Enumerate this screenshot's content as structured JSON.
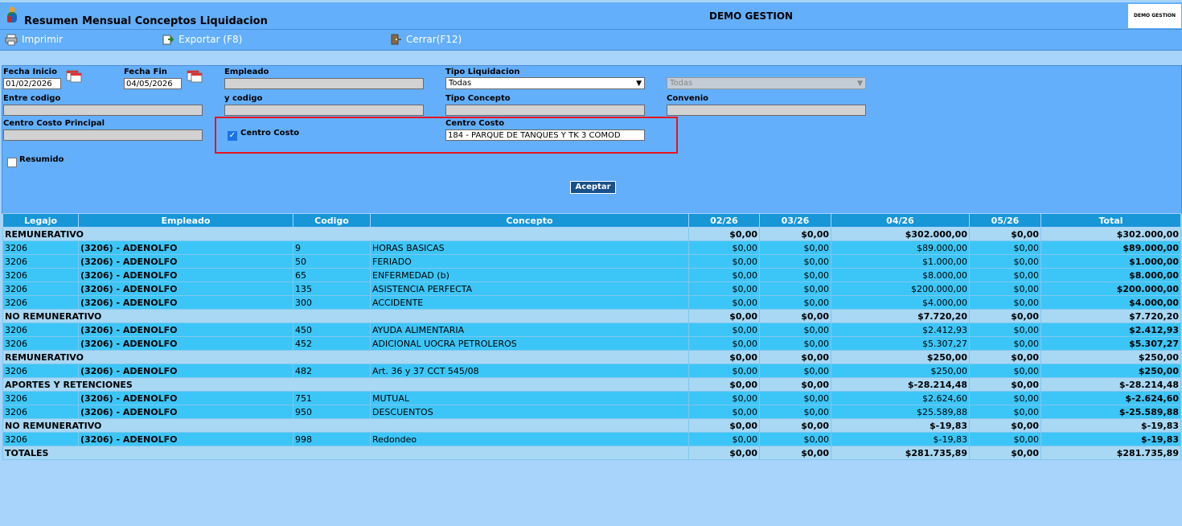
{
  "header": {
    "app_title": "Resumen Mensual Conceptos Liquidacion",
    "center_title": "DEMO GESTION",
    "brand": "DEMO GESTION"
  },
  "toolbar": {
    "print_label": "Imprimir",
    "export_label": "Exportar (F8)",
    "close_label": "Cerrar(F12)"
  },
  "filters": {
    "fecha_inicio_label": "Fecha Inicio",
    "fecha_inicio_value": "01/02/2026",
    "fecha_fin_label": "Fecha Fin",
    "fecha_fin_value": "04/05/2026",
    "empleado_label": "Empleado",
    "tipo_liq_label": "Tipo Liquidacion",
    "tipo_liq_value": "Todas",
    "extra_select_value": "Todas",
    "entre_codigo_label": "Entre codigo",
    "y_codigo_label": "y codigo",
    "tipo_concepto_label": "Tipo Concepto",
    "convenio_label": "Convenio",
    "centro_costo_principal_label": "Centro Costo Principal",
    "centro_costo_chk_label": "Centro Costo",
    "centro_costo_label": "Centro Costo",
    "centro_costo_value": "184 - PARQUE DE TANQUES Y TK 3 COMOD",
    "resumido_label": "Resumido",
    "accept_label": "Aceptar"
  },
  "table": {
    "columns": [
      "Legajo",
      "Empleado",
      "Codigo",
      "Concepto",
      "02/26",
      "03/26",
      "04/26",
      "05/26",
      "Total"
    ],
    "rows": [
      {
        "type": "grp",
        "title": "REMUNERATIVO",
        "vals": [
          "$0,00",
          "$0,00",
          "$302.000,00",
          "$0,00",
          "$302.000,00"
        ]
      },
      {
        "type": "det",
        "legajo": "3206",
        "empleado": "(3206) - ADENOLFO",
        "codigo": "9",
        "concepto": "HORAS BASICAS",
        "vals": [
          "$0,00",
          "$0,00",
          "$89.000,00",
          "$0,00",
          "$89.000,00"
        ]
      },
      {
        "type": "det",
        "legajo": "3206",
        "empleado": "(3206) - ADENOLFO",
        "codigo": "50",
        "concepto": "FERIADO",
        "vals": [
          "$0,00",
          "$0,00",
          "$1.000,00",
          "$0,00",
          "$1.000,00"
        ]
      },
      {
        "type": "det",
        "legajo": "3206",
        "empleado": "(3206) - ADENOLFO",
        "codigo": "65",
        "concepto": "ENFERMEDAD (b)",
        "vals": [
          "$0,00",
          "$0,00",
          "$8.000,00",
          "$0,00",
          "$8.000,00"
        ]
      },
      {
        "type": "det",
        "legajo": "3206",
        "empleado": "(3206) - ADENOLFO",
        "codigo": "135",
        "concepto": "ASISTENCIA PERFECTA",
        "vals": [
          "$0,00",
          "$0,00",
          "$200.000,00",
          "$0,00",
          "$200.000,00"
        ]
      },
      {
        "type": "det",
        "legajo": "3206",
        "empleado": "(3206) - ADENOLFO",
        "codigo": "300",
        "concepto": "ACCIDENTE",
        "vals": [
          "$0,00",
          "$0,00",
          "$4.000,00",
          "$0,00",
          "$4.000,00"
        ]
      },
      {
        "type": "grp",
        "title": "NO REMUNERATIVO",
        "vals": [
          "$0,00",
          "$0,00",
          "$7.720,20",
          "$0,00",
          "$7.720,20"
        ]
      },
      {
        "type": "det",
        "legajo": "3206",
        "empleado": "(3206) - ADENOLFO",
        "codigo": "450",
        "concepto": "AYUDA ALIMENTARIA",
        "vals": [
          "$0,00",
          "$0,00",
          "$2.412,93",
          "$0,00",
          "$2.412,93"
        ]
      },
      {
        "type": "det",
        "legajo": "3206",
        "empleado": "(3206) - ADENOLFO",
        "codigo": "452",
        "concepto": "ADICIONAL UOCRA PETROLEROS",
        "vals": [
          "$0,00",
          "$0,00",
          "$5.307,27",
          "$0,00",
          "$5.307,27"
        ]
      },
      {
        "type": "grp",
        "title": "REMUNERATIVO",
        "vals": [
          "$0,00",
          "$0,00",
          "$250,00",
          "$0,00",
          "$250,00"
        ]
      },
      {
        "type": "det",
        "legajo": "3206",
        "empleado": "(3206) - ADENOLFO",
        "codigo": "482",
        "concepto": "Art. 36 y 37 CCT 545/08",
        "vals": [
          "$0,00",
          "$0,00",
          "$250,00",
          "$0,00",
          "$250,00"
        ]
      },
      {
        "type": "grp",
        "title": "APORTES Y RETENCIONES",
        "vals": [
          "$0,00",
          "$0,00",
          "$-28.214,48",
          "$0,00",
          "$-28.214,48"
        ]
      },
      {
        "type": "det",
        "legajo": "3206",
        "empleado": "(3206) - ADENOLFO",
        "codigo": "751",
        "concepto": "MUTUAL",
        "vals": [
          "$0,00",
          "$0,00",
          "$2.624,60",
          "$0,00",
          "$-2.624,60"
        ]
      },
      {
        "type": "det",
        "legajo": "3206",
        "empleado": "(3206) - ADENOLFO",
        "codigo": "950",
        "concepto": "DESCUENTOS",
        "vals": [
          "$0,00",
          "$0,00",
          "$25.589,88",
          "$0,00",
          "$-25.589,88"
        ]
      },
      {
        "type": "grp",
        "title": "NO REMUNERATIVO",
        "vals": [
          "$0,00",
          "$0,00",
          "$-19,83",
          "$0,00",
          "$-19,83"
        ]
      },
      {
        "type": "det",
        "legajo": "3206",
        "empleado": "(3206) - ADENOLFO",
        "codigo": "998",
        "concepto": "Redondeo",
        "vals": [
          "$0,00",
          "$0,00",
          "$-19,83",
          "$0,00",
          "$-19,83"
        ]
      },
      {
        "type": "tot",
        "title": "TOTALES",
        "vals": [
          "$0,00",
          "$0,00",
          "$281.735,89",
          "$0,00",
          "$281.735,89"
        ]
      }
    ]
  }
}
